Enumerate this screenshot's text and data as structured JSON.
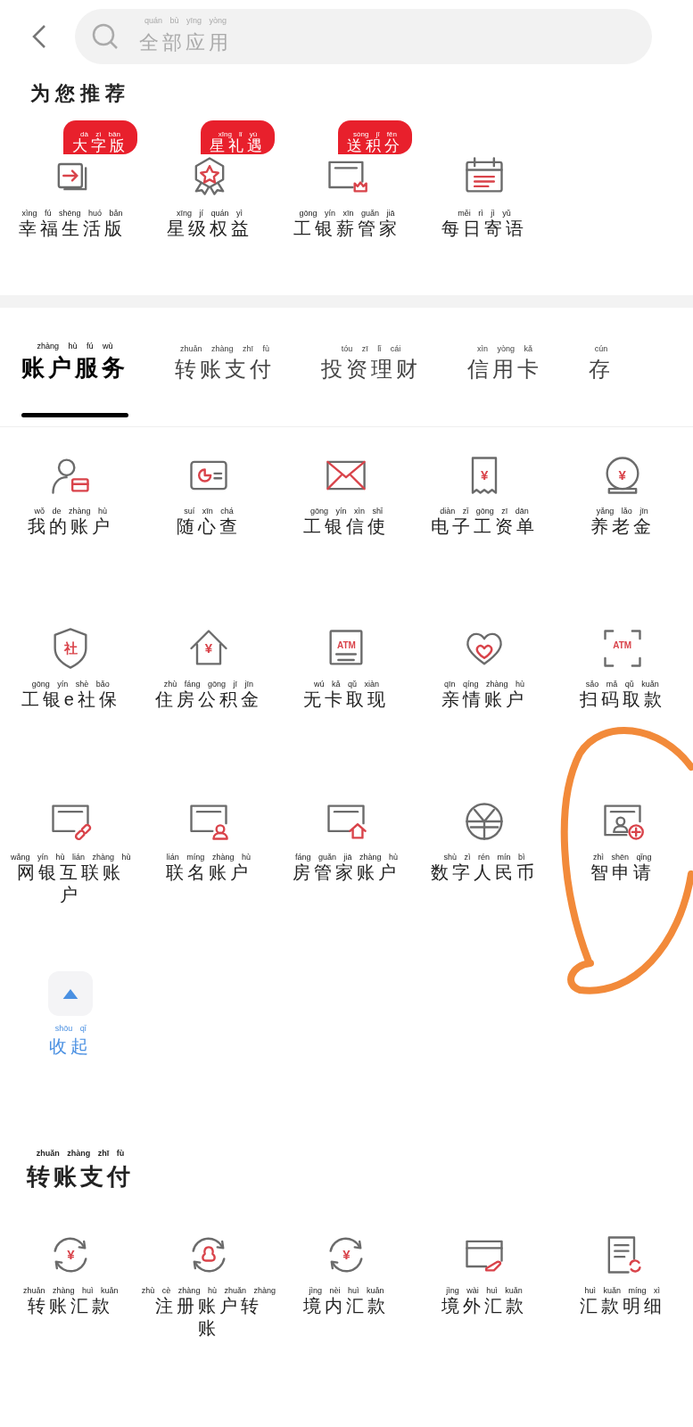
{
  "search": {
    "placeholder": "全部应用",
    "pinyin": "quán bù yīng yòng"
  },
  "recommend": {
    "title": "为您推荐",
    "items": [
      {
        "label": "幸福生活版",
        "pinyin": "xìng fú shēng huó bǎn",
        "badge": {
          "label": "大字版",
          "pinyin": "dà zì bǎn"
        }
      },
      {
        "label": "星级权益",
        "pinyin": "xīng jí quán yì",
        "badge": {
          "label": "星礼遇",
          "pinyin": "xīng lǐ yù"
        }
      },
      {
        "label": "工银薪管家",
        "pinyin": "gōng yín xīn guǎn jiā",
        "badge": {
          "label": "送积分",
          "pinyin": "sòng jī fēn"
        }
      },
      {
        "label": "每日寄语",
        "pinyin": "měi rì jì yǔ"
      }
    ]
  },
  "tabs": [
    {
      "label": "账户服务",
      "pinyin": "zhàng hù fú wù",
      "selected": true
    },
    {
      "label": "转账支付",
      "pinyin": "zhuǎn zhàng zhī fù",
      "selected": false
    },
    {
      "label": "投资理财",
      "pinyin": "tóu zī lǐ cái",
      "selected": false
    },
    {
      "label": "信用卡",
      "pinyin": "xìn yòng kǎ",
      "selected": false
    },
    {
      "label": "存",
      "pinyin": "cún",
      "selected": false
    }
  ],
  "account_services": {
    "items": [
      {
        "label": "我的账户",
        "pinyin": "wǒ de zhàng hù"
      },
      {
        "label": "随心查",
        "pinyin": "suí xīn chá"
      },
      {
        "label": "工银信使",
        "pinyin": "gōng yín xìn shǐ"
      },
      {
        "label": "电子工资单",
        "pinyin": "diàn zǐ gōng zī dān",
        "icon_text": "¥"
      },
      {
        "label": "养老金",
        "pinyin": "yǎng lǎo jīn",
        "icon_text": "¥"
      },
      {
        "label": "工银e社保",
        "pinyin": "gōng yín shè bǎo",
        "icon_text": "社"
      },
      {
        "label": "住房公积金",
        "pinyin": "zhù fáng gōng jī jīn",
        "icon_text": "¥"
      },
      {
        "label": "无卡取现",
        "pinyin": "wú kǎ qǔ xiàn",
        "icon_text": "ATM"
      },
      {
        "label": "亲情账户",
        "pinyin": "qīn qíng zhàng hù"
      },
      {
        "label": "扫码取款",
        "pinyin": "sǎo mǎ qǔ kuǎn",
        "icon_text": "ATM"
      },
      {
        "label": "网银互联账户",
        "pinyin": "wǎng yín hù lián zhàng hù"
      },
      {
        "label": "联名账户",
        "pinyin": "lián míng zhàng hù"
      },
      {
        "label": "房管家账户",
        "pinyin": "fáng guǎn jiā zhàng hù"
      },
      {
        "label": "数字人民币",
        "pinyin": "shù zì rén mín bì"
      },
      {
        "label": "智申请",
        "pinyin": "zhì shēn qǐng"
      }
    ],
    "collapse": {
      "label": "收起",
      "pinyin": "shōu qǐ"
    }
  },
  "transfer": {
    "title": "转账支付",
    "pinyin": "zhuǎn zhàng zhī fù",
    "items": [
      {
        "label": "转账汇款",
        "pinyin": "zhuǎn zhàng huì kuǎn",
        "icon_text": "¥"
      },
      {
        "label": "注册账户转账",
        "pinyin": "zhù cè zhàng hù zhuǎn zhàng"
      },
      {
        "label": "境内汇款",
        "pinyin": "jìng nèi huì kuǎn",
        "icon_text": "¥"
      },
      {
        "label": "境外汇款",
        "pinyin": "jìng wài huì kuǎn"
      },
      {
        "label": "汇款明细",
        "pinyin": "huì kuǎn míng xì"
      }
    ]
  }
}
